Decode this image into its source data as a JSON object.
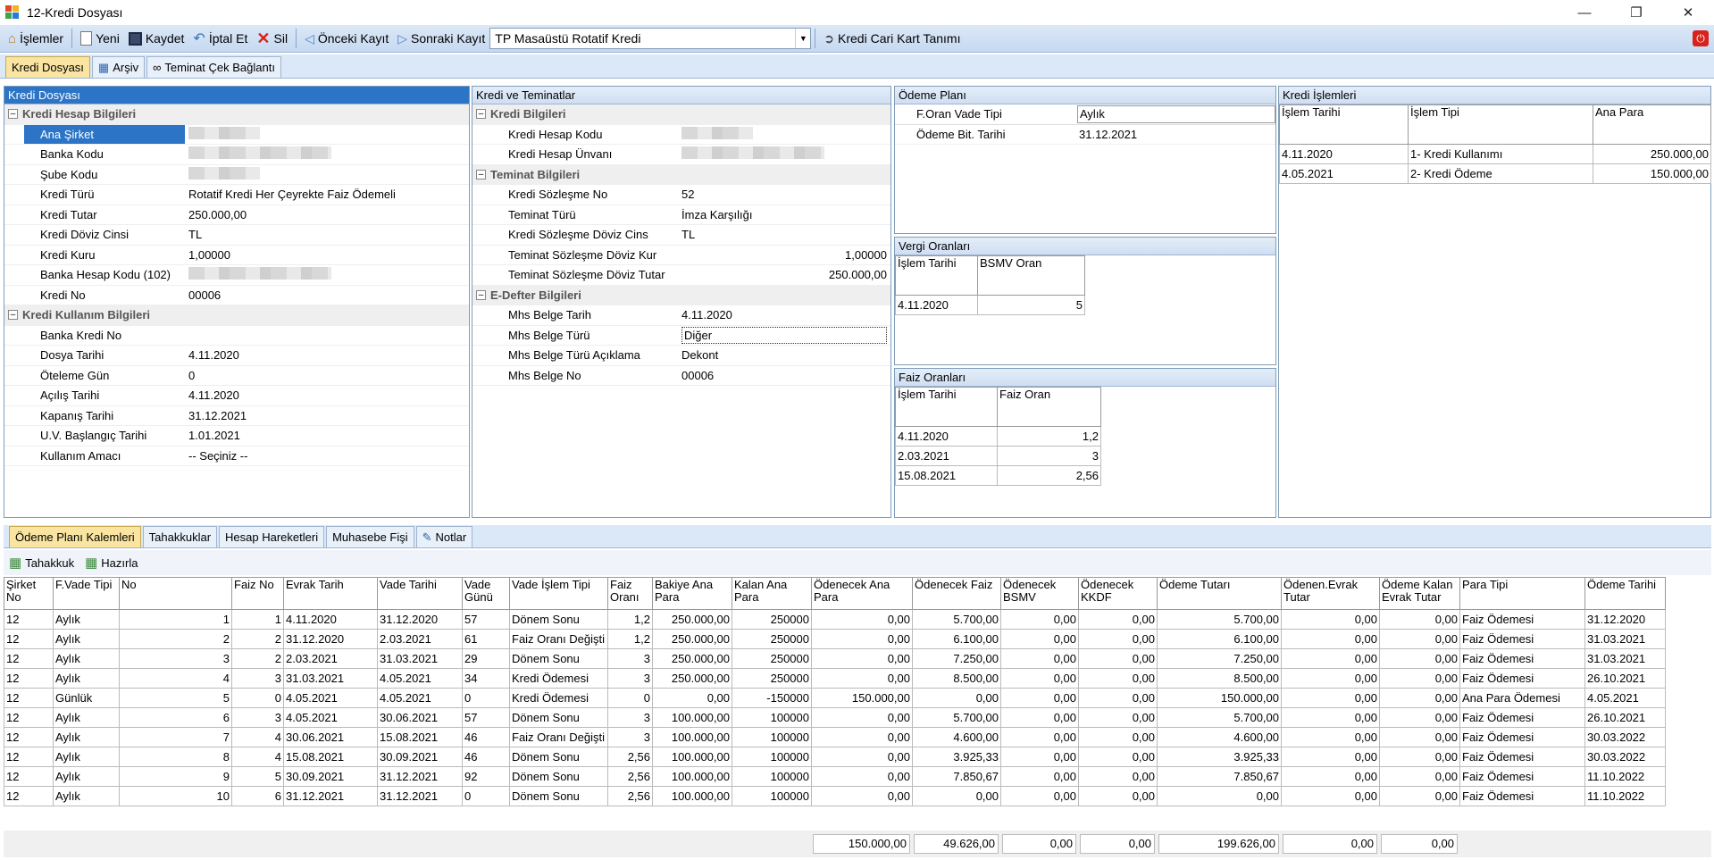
{
  "title": "12-Kredi Dosyası",
  "toolbar": {
    "islemler": "İşlemler",
    "yeni": "Yeni",
    "kaydet": "Kaydet",
    "iptal": "İptal Et",
    "sil": "Sil",
    "onceki": "Önceki Kayıt",
    "sonraki": "Sonraki Kayıt",
    "combo_value": "TP Masaüstü Rotatif Kredi",
    "cari_kart": "Kredi Cari Kart Tanımı"
  },
  "top_tabs": [
    "Kredi Dosyası",
    "Arşiv",
    "Teminat Çek Bağlantı"
  ],
  "kredi_dosyasi": {
    "header": "Kredi Dosyası",
    "groups": [
      {
        "title": "Kredi Hesap Bilgileri",
        "rows": [
          {
            "label": "Ana Şirket",
            "value": "",
            "blur": true,
            "selected": true
          },
          {
            "label": "Banka Kodu",
            "value": "",
            "blur": true
          },
          {
            "label": "Şube Kodu",
            "value": "",
            "blur": true
          },
          {
            "label": "Kredi Türü",
            "value": "Rotatif Kredi Her Çeyrekte Faiz Ödemeli"
          },
          {
            "label": "Kredi Tutar",
            "value": "250.000,00"
          },
          {
            "label": "Kredi Döviz Cinsi",
            "value": "TL"
          },
          {
            "label": "Kredi Kuru",
            "value": "1,00000"
          },
          {
            "label": "Banka Hesap Kodu (102)",
            "value": "",
            "blur": true
          },
          {
            "label": "Kredi No",
            "value": "00006"
          }
        ]
      },
      {
        "title": "Kredi Kullanım Bilgileri",
        "rows": [
          {
            "label": "Banka Kredi No",
            "value": ""
          },
          {
            "label": "Dosya Tarihi",
            "value": "4.11.2020"
          },
          {
            "label": "Öteleme Gün",
            "value": "0"
          },
          {
            "label": "Açılış Tarihi",
            "value": "4.11.2020"
          },
          {
            "label": "Kapanış Tarihi",
            "value": "31.12.2021"
          },
          {
            "label": "U.V. Başlangıç Tarihi",
            "value": "1.01.2021"
          },
          {
            "label": "Kullanım Amacı",
            "value": "-- Seçiniz --"
          }
        ]
      }
    ]
  },
  "kredi_teminat": {
    "header": "Kredi ve Teminatlar",
    "groups": [
      {
        "title": "Kredi Bilgileri",
        "rows": [
          {
            "label": "Kredi Hesap Kodu",
            "value": "",
            "blur": true
          },
          {
            "label": "Kredi Hesap Ünvanı",
            "value": "",
            "blur": true
          }
        ]
      },
      {
        "title": "Teminat Bilgileri",
        "rows": [
          {
            "label": "Kredi Sözleşme No",
            "value": "52"
          },
          {
            "label": "Teminat Türü",
            "value": "İmza Karşılığı"
          },
          {
            "label": "Kredi Sözleşme Döviz Cins",
            "value": "TL"
          },
          {
            "label": "Teminat Sözleşme Döviz Kur",
            "value": "1,00000",
            "right": true
          },
          {
            "label": "Teminat Sözleşme Döviz Tutar",
            "value": "250.000,00",
            "right": true
          }
        ]
      },
      {
        "title": "E-Defter Bilgileri",
        "rows": [
          {
            "label": "Mhs Belge Tarih",
            "value": "4.11.2020"
          },
          {
            "label": "Mhs Belge Türü",
            "value": "Diğer",
            "box": true
          },
          {
            "label": "Mhs Belge Türü Açıklama",
            "value": "Dekont"
          },
          {
            "label": "Mhs Belge No",
            "value": "00006"
          }
        ]
      }
    ]
  },
  "odeme_plani": {
    "header": "Ödeme Planı",
    "rows": [
      {
        "label": "F.Oran Vade Tipi",
        "value": "Aylık"
      },
      {
        "label": "Ödeme Bit. Tarihi",
        "value": "31.12.2021"
      }
    ]
  },
  "vergi": {
    "header": "Vergi Oranları",
    "cols": [
      "İşlem Tarihi",
      "BSMV Oran"
    ],
    "rows": [
      [
        "4.11.2020",
        "5"
      ]
    ]
  },
  "faiz": {
    "header": "Faiz Oranları",
    "cols": [
      "İşlem Tarihi",
      "Faiz Oran"
    ],
    "rows": [
      [
        "4.11.2020",
        "1,2"
      ],
      [
        "2.03.2021",
        "3"
      ],
      [
        "15.08.2021",
        "2,56"
      ]
    ]
  },
  "kredi_islemleri": {
    "header": "Kredi İşlemleri",
    "cols": [
      "İşlem Tarihi",
      "İşlem Tipi",
      "Ana Para"
    ],
    "rows": [
      [
        "4.11.2020",
        "1- Kredi Kullanımı",
        "250.000,00"
      ],
      [
        "4.05.2021",
        "2- Kredi Ödeme",
        "150.000,00"
      ]
    ]
  },
  "bottom_tabs": [
    "Ödeme Planı Kalemleri",
    "Tahakkuklar",
    "Hesap Hareketleri",
    "Muhasebe Fişi",
    "Notlar"
  ],
  "bottom_toolbar": {
    "tahakkuk": "Tahakkuk",
    "hazirla": "Hazırla"
  },
  "plan": {
    "cols": [
      "Şirket No",
      "F.Vade Tipi",
      "No",
      "Faiz No",
      "Evrak Tarih",
      "Vade Tarihi",
      "Vade Günü",
      "Vade İşlem Tipi",
      "Faiz Oranı",
      "Bakiye Ana Para",
      "Kalan Ana Para",
      "Ödenecek Ana Para",
      "Ödenecek Faiz",
      "Ödenecek BSMV",
      "Ödenecek KKDF",
      "Ödeme Tutarı",
      "Ödenen.Evrak Tutar",
      "Ödeme Kalan Evrak Tutar",
      "Para Tipi",
      "Ödeme Tarihi"
    ],
    "rows": [
      [
        "12",
        "Aylık",
        "1",
        "1",
        "4.11.2020",
        "31.12.2020",
        "57",
        "Dönem Sonu",
        "1,2",
        "250.000,00",
        "250000",
        "0,00",
        "5.700,00",
        "0,00",
        "0,00",
        "5.700,00",
        "0,00",
        "0,00",
        "Faiz Ödemesi",
        "31.12.2020"
      ],
      [
        "12",
        "Aylık",
        "2",
        "2",
        "31.12.2020",
        "2.03.2021",
        "61",
        "Faiz Oranı Değişti",
        "1,2",
        "250.000,00",
        "250000",
        "0,00",
        "6.100,00",
        "0,00",
        "0,00",
        "6.100,00",
        "0,00",
        "0,00",
        "Faiz Ödemesi",
        "31.03.2021"
      ],
      [
        "12",
        "Aylık",
        "3",
        "2",
        "2.03.2021",
        "31.03.2021",
        "29",
        "Dönem Sonu",
        "3",
        "250.000,00",
        "250000",
        "0,00",
        "7.250,00",
        "0,00",
        "0,00",
        "7.250,00",
        "0,00",
        "0,00",
        "Faiz Ödemesi",
        "31.03.2021"
      ],
      [
        "12",
        "Aylık",
        "4",
        "3",
        "31.03.2021",
        "4.05.2021",
        "34",
        "Kredi Ödemesi",
        "3",
        "250.000,00",
        "250000",
        "0,00",
        "8.500,00",
        "0,00",
        "0,00",
        "8.500,00",
        "0,00",
        "0,00",
        "Faiz Ödemesi",
        "26.10.2021"
      ],
      [
        "12",
        "Günlük",
        "5",
        "0",
        "4.05.2021",
        "4.05.2021",
        "0",
        "Kredi Ödemesi",
        "0",
        "0,00",
        "-150000",
        "150.000,00",
        "0,00",
        "0,00",
        "0,00",
        "150.000,00",
        "0,00",
        "0,00",
        "Ana Para Ödemesi",
        "4.05.2021"
      ],
      [
        "12",
        "Aylık",
        "6",
        "3",
        "4.05.2021",
        "30.06.2021",
        "57",
        "Dönem Sonu",
        "3",
        "100.000,00",
        "100000",
        "0,00",
        "5.700,00",
        "0,00",
        "0,00",
        "5.700,00",
        "0,00",
        "0,00",
        "Faiz Ödemesi",
        "26.10.2021"
      ],
      [
        "12",
        "Aylık",
        "7",
        "4",
        "30.06.2021",
        "15.08.2021",
        "46",
        "Faiz Oranı Değişti",
        "3",
        "100.000,00",
        "100000",
        "0,00",
        "4.600,00",
        "0,00",
        "0,00",
        "4.600,00",
        "0,00",
        "0,00",
        "Faiz Ödemesi",
        "30.03.2022"
      ],
      [
        "12",
        "Aylık",
        "8",
        "4",
        "15.08.2021",
        "30.09.2021",
        "46",
        "Dönem Sonu",
        "2,56",
        "100.000,00",
        "100000",
        "0,00",
        "3.925,33",
        "0,00",
        "0,00",
        "3.925,33",
        "0,00",
        "0,00",
        "Faiz Ödemesi",
        "30.03.2022"
      ],
      [
        "12",
        "Aylık",
        "9",
        "5",
        "30.09.2021",
        "31.12.2021",
        "92",
        "Dönem Sonu",
        "2,56",
        "100.000,00",
        "100000",
        "0,00",
        "7.850,67",
        "0,00",
        "0,00",
        "7.850,67",
        "0,00",
        "0,00",
        "Faiz Ödemesi",
        "11.10.2022"
      ],
      [
        "12",
        "Aylık",
        "10",
        "6",
        "31.12.2021",
        "31.12.2021",
        "0",
        "Dönem Sonu",
        "2,56",
        "100.000,00",
        "100000",
        "0,00",
        "0,00",
        "0,00",
        "0,00",
        "0,00",
        "0,00",
        "0,00",
        "Faiz Ödemesi",
        "11.10.2022"
      ]
    ],
    "totals": [
      "150.000,00",
      "49.626,00",
      "0,00",
      "0,00",
      "199.626,00",
      "0,00",
      "0,00"
    ]
  }
}
